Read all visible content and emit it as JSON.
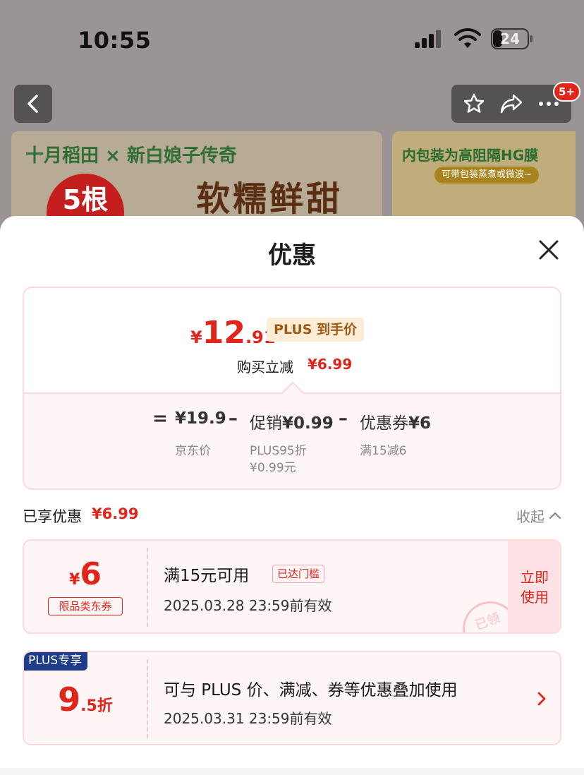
{
  "status_bar": {
    "time": "10:55",
    "battery": "24"
  },
  "nav": {
    "notification_badge": "5+"
  },
  "banner": {
    "brand": "十月稻田 × 新白娘子传奇",
    "headline": "软糯鲜甜",
    "badge": "5根",
    "side_title": "内包装为高阻隔HG膜",
    "side_subtitle": "可带包装蒸煮或微波~"
  },
  "sheet": {
    "title": "优惠",
    "final_price": {
      "currency": "¥",
      "integer": "12",
      "decimal": ".91",
      "tag": "PLUS 到手价"
    },
    "instant_discount": {
      "label": "购买立减",
      "value": "¥6.99"
    },
    "breakdown": {
      "jd_price": {
        "value": "¥19.9",
        "label": "京东价"
      },
      "promo": {
        "prefix": "促销",
        "value": "¥0.99",
        "desc_line1": "PLUS95折",
        "desc_line2": "¥0.99元"
      },
      "coupon": {
        "prefix": "优惠券",
        "value": "¥6",
        "desc": "满15减6"
      }
    },
    "enjoyed": {
      "label": "已享优惠",
      "value": "¥6.99",
      "collapse": "收起"
    },
    "coupons": [
      {
        "currency": "¥",
        "amount": "6",
        "type": "限品类东券",
        "condition": "满15元可用",
        "status_tag": "已达门槛",
        "validity": "2025.03.28 23:59前有效",
        "action_line1": "立即",
        "action_line2": "使用",
        "stamp": "已领"
      },
      {
        "badge": "PLUS专享",
        "amount_int": "9",
        "amount_rest": ".5折",
        "description": "可与 PLUS 价、满减、券等优惠叠加使用",
        "validity": "2025.03.31 23:59前有效"
      }
    ]
  },
  "colors": {
    "accent_red": "#e1251b",
    "plus_navy": "#1f3c8a",
    "card_border": "#fbd9dd",
    "card_bg": "#fef5f6"
  }
}
